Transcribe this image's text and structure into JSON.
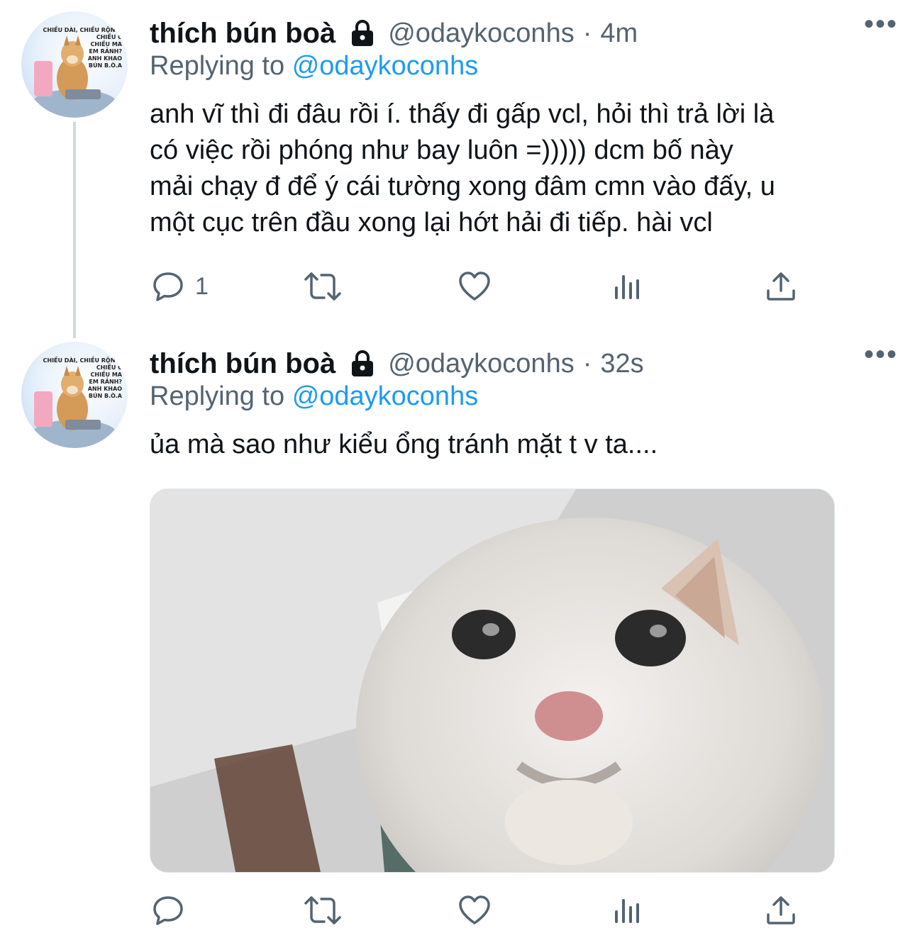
{
  "colors": {
    "accent": "#1d9bf0",
    "secondary_text": "#536471",
    "primary_text": "#0f1419",
    "thread_line": "#cfd9de"
  },
  "tweets": [
    {
      "display_name": "thích bún boà",
      "handle": "@odaykoconhs",
      "separator": "·",
      "time": "4m",
      "more_label": "•••",
      "replying_prefix": "Replying to",
      "replying_to": "@odaykoconhs",
      "text": "anh vĩ thì đi đâu rồi í. thấy đi gấp vcl, hỏi thì trả lời là\ncó việc rồi phóng như bay luôn =))))) dcm bố này\nmải chạy đ để ý cái tường xong đâm cmn vào đấy, u\nmột cục trên đầu xong lại hớt hải đi tiếp. hài vcl",
      "avatar_text": "CHIỀU DÀI, CHIỀU RỘNG, CHIỀU C\nCHIỀU MA\nEM RẢNH?\nANH KHAO\nBÚN B.Ò.A",
      "reply_count": "1",
      "icons": [
        "reply-icon",
        "retweet-icon",
        "like-icon",
        "analytics-icon",
        "share-icon",
        "lock-icon"
      ]
    },
    {
      "display_name": "thích bún boà",
      "handle": "@odaykoconhs",
      "separator": "·",
      "time": "32s",
      "more_label": "•••",
      "replying_prefix": "Replying to",
      "replying_to": "@odaykoconhs",
      "text": "ủa mà sao như kiểu ổng tránh mặt t v ta....",
      "avatar_text": "CHIỀU DÀI, CHIỀU RỘNG, CHIỀU C\nCHIỀU MA\nEM RẢNH?\nANH KHAO\nBÚN B.Ò.A",
      "reply_count": "",
      "media": "crying-cat-photo",
      "icons": [
        "reply-icon",
        "retweet-icon",
        "like-icon",
        "analytics-icon",
        "share-icon",
        "lock-icon"
      ]
    }
  ]
}
